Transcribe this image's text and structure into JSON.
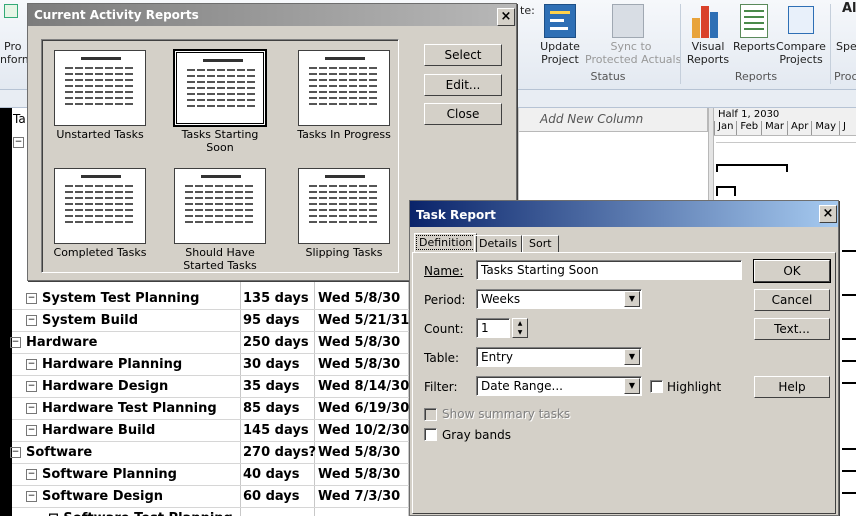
{
  "ribbon": {
    "left_partial_1": "Pro",
    "left_partial_2": "nform",
    "update_project": "Update\nProject",
    "sync": "Sync to\nProtected Actuals",
    "visual_reports": "Visual\nReports",
    "reports": "Reports",
    "compare_projects": "Compare\nProjects",
    "spe": "Spe",
    "status_group": "Status",
    "reports_group": "Reports",
    "proc_group": "Proc",
    "al": "Al",
    "te": "te:"
  },
  "table": {
    "ta_header": "Ta",
    "add_new_column": "Add New Column",
    "timescale_top": "Half 1, 2030",
    "months": [
      "Jan",
      "Feb",
      "Mar",
      "Apr",
      "May",
      "J"
    ],
    "rows": [
      {
        "name": "System Test Planning",
        "duration": "135 days",
        "start": "Wed 5/8/30",
        "indent": 2
      },
      {
        "name": "System Build",
        "duration": "95 days",
        "start": "Wed 5/21/31",
        "indent": 2
      },
      {
        "name": "Hardware",
        "duration": "250 days",
        "start": "Wed 5/8/30",
        "indent": 1
      },
      {
        "name": "Hardware Planning",
        "duration": "30 days",
        "start": "Wed 5/8/30",
        "indent": 2
      },
      {
        "name": "Hardware Design",
        "duration": "35 days",
        "start": "Wed 8/14/30",
        "indent": 2
      },
      {
        "name": "Hardware Test Planning",
        "duration": "85 days",
        "start": "Wed 6/19/30",
        "indent": 2
      },
      {
        "name": "Hardware Build",
        "duration": "145 days",
        "start": "Wed 10/2/30",
        "indent": 2
      },
      {
        "name": "Software",
        "duration": "270 days?",
        "start": "Wed 5/8/30",
        "indent": 1
      },
      {
        "name": "Software Planning",
        "duration": "40 days",
        "start": "Wed 5/8/30",
        "indent": 2
      },
      {
        "name": "Software Design",
        "duration": "60 days",
        "start": "Wed 7/3/30",
        "indent": 2
      }
    ]
  },
  "car": {
    "title": "Current Activity Reports",
    "close_glyph": "×",
    "tiles": [
      "Unstarted Tasks",
      "Tasks Starting\nSoon",
      "Tasks In Progress",
      "Completed Tasks",
      "Should Have\nStarted Tasks",
      "Slipping Tasks"
    ],
    "select": "Select",
    "edit": "Edit...",
    "close": "Close"
  },
  "tr": {
    "title": "Task Report",
    "close_glyph": "×",
    "tabs": [
      "Definition",
      "Details",
      "Sort"
    ],
    "name_label": "Name:",
    "name_value": "Tasks Starting Soon",
    "period_label": "Period:",
    "period_value": "Weeks",
    "count_label": "Count:",
    "count_value": "1",
    "table_label": "Table:",
    "table_value": "Entry",
    "filter_label": "Filter:",
    "filter_value": "Date Range...",
    "highlight": "Highlight",
    "show_summary": "Show summary tasks",
    "gray_bands": "Gray bands",
    "ok": "OK",
    "cancel": "Cancel",
    "text": "Text...",
    "help": "Help"
  }
}
